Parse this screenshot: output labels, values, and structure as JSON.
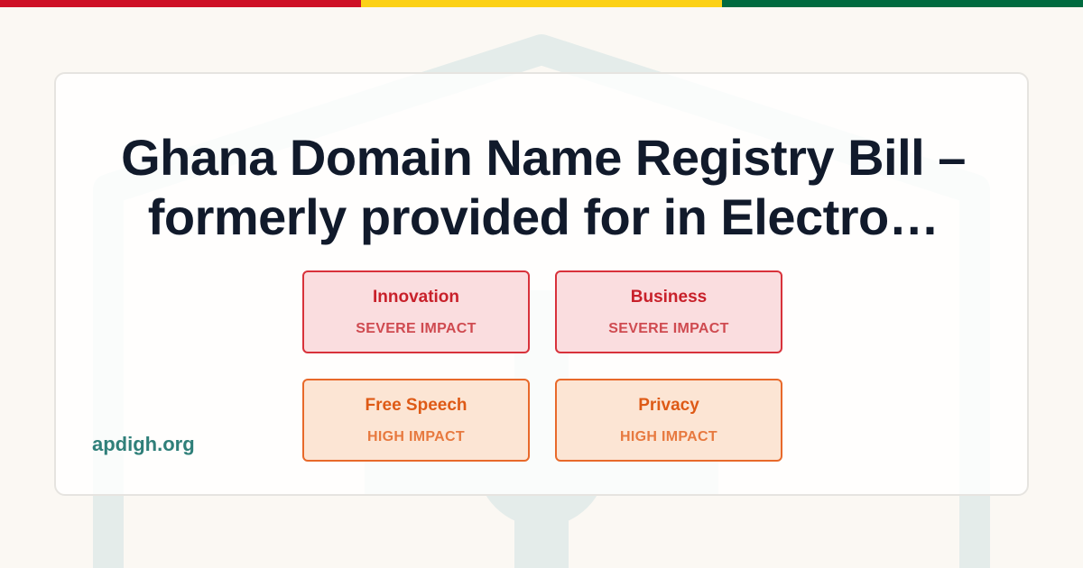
{
  "flag_colors": [
    "#ce1126",
    "#fcd116",
    "#006b3f"
  ],
  "title": "Ghana Domain Name Registry Bill – formerly provided for in Electro…",
  "title_line1": "Ghana Domain Name Registry Bill –",
  "title_line2": "formerly provided for in Electro…",
  "site": "apdigh.org",
  "impacts": [
    {
      "area": "Innovation",
      "level": "SEVERE IMPACT",
      "severity": "severe"
    },
    {
      "area": "Business",
      "level": "SEVERE IMPACT",
      "severity": "severe"
    },
    {
      "area": "Free Speech",
      "level": "HIGH IMPACT",
      "severity": "high"
    },
    {
      "area": "Privacy",
      "level": "HIGH IMPACT",
      "severity": "high"
    }
  ],
  "colors": {
    "title": "#111a2b",
    "site": "#2f7f79",
    "severe_border": "#d8323b",
    "high_border": "#e8692a",
    "watermark": "#e4ecea"
  }
}
